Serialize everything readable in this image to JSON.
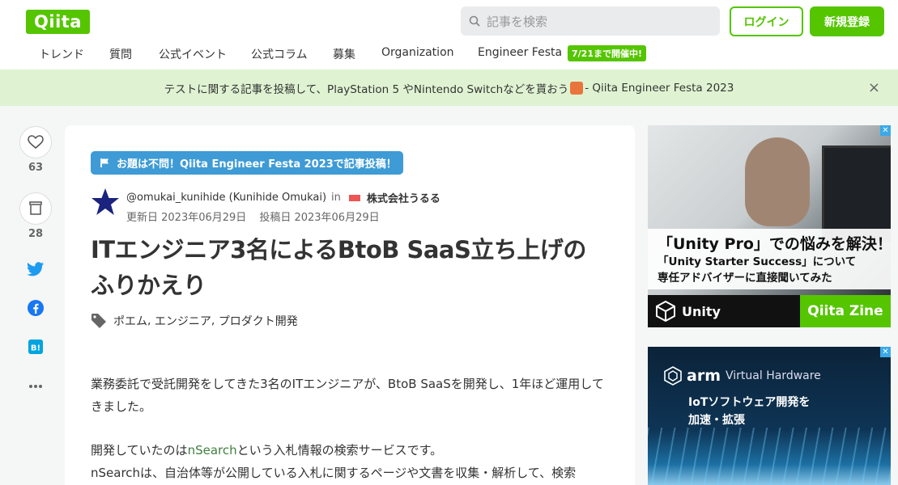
{
  "header": {
    "logo": "Qiita",
    "search_placeholder": "記事を検索",
    "login": "ログイン",
    "signup": "新規登録",
    "nav": [
      "トレンド",
      "質問",
      "公式イベント",
      "公式コラム",
      "募集",
      "Organization",
      "Engineer Festa"
    ],
    "nav_badge": "7/21まで開催中!"
  },
  "banner": {
    "text_before": "テストに関する記事を投稿して、PlayStation 5 やNintendo Switchなどを貰おう",
    "text_after": "- Qiita Engineer Festa 2023",
    "close": "×"
  },
  "actions": {
    "like_count": "63",
    "stock_count": "28"
  },
  "article": {
    "event_tag": "お題は不問！Qiita Engineer Festa 2023で記事投稿！",
    "author": "@omukai_kunihide (Kunihide Omukai)",
    "in": "in",
    "organization": "株式会社うるる",
    "updated": "更新日 2023年06月29日",
    "posted": "投稿日 2023年06月29日",
    "title": "ITエンジニア3名によるBtoB SaaS立ち上げのふりかえり",
    "tags": [
      "ポエム",
      "エンジニア",
      "プロダクト開発"
    ],
    "p1": "業務委託で受託開発をしてきた3名のITエンジニアが、BtoB SaaSを開発し、1年ほど運用してきました。",
    "p2_before": "開発していたのは",
    "p2_link": "nSearch",
    "p2_after": "という入札情報の検索サービスです。",
    "p3": "nSearchは、自治体等が公開している入札に関するページや文書を収集・解析して、検索"
  },
  "ads": {
    "ad1_line1": "「Unity Pro」での悩みを解決！",
    "ad1_line2": "「Unity Starter Success」について",
    "ad1_line3": "専任アドバイザーに直接聞いてみた",
    "ad1_unity": "Unity",
    "ad1_zine": "Qiita Zine",
    "ad2_brand": "arm",
    "ad2_sub": "Virtual Hardware",
    "ad2_line1": "IoTソフトウェア開発を",
    "ad2_line2": "加速・拡張"
  }
}
